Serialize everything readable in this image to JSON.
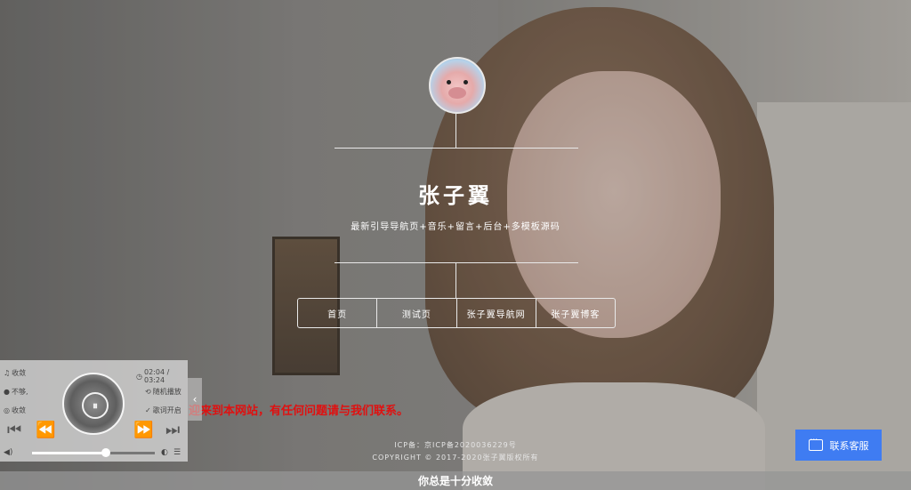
{
  "profile": {
    "name": "张子翼",
    "tagline": "最新引导导航页+音乐+留言+后台+多模板源码"
  },
  "nav": {
    "items": [
      "首页",
      "测试页",
      "张子翼导航网",
      "张子翼博客"
    ]
  },
  "announcement": "迎来到本网站，有任何问题请与我们联系。",
  "footer": {
    "icp": "ICP备：京ICP备2020036229号",
    "copyright": "COPYRIGHT © 2017-2020张子翼版权所有"
  },
  "bottom_bar_text": "你总是十分收敛",
  "contact_button": "联系客服",
  "player": {
    "song": "收敛",
    "artist": "不够,",
    "album": "收敛",
    "time": "02:04 / 03:24",
    "mode": "随机播放",
    "lyrics": "歌词开启",
    "progress_fraction": 0.6,
    "icons": {
      "song": "music-note-icon",
      "artist": "user-icon",
      "album": "disc-icon",
      "time": "clock-icon",
      "mode": "shuffle-icon",
      "lyrics": "check-circle-icon"
    }
  },
  "colors": {
    "accent": "#3f7cf2",
    "announcement": "#e01010"
  }
}
